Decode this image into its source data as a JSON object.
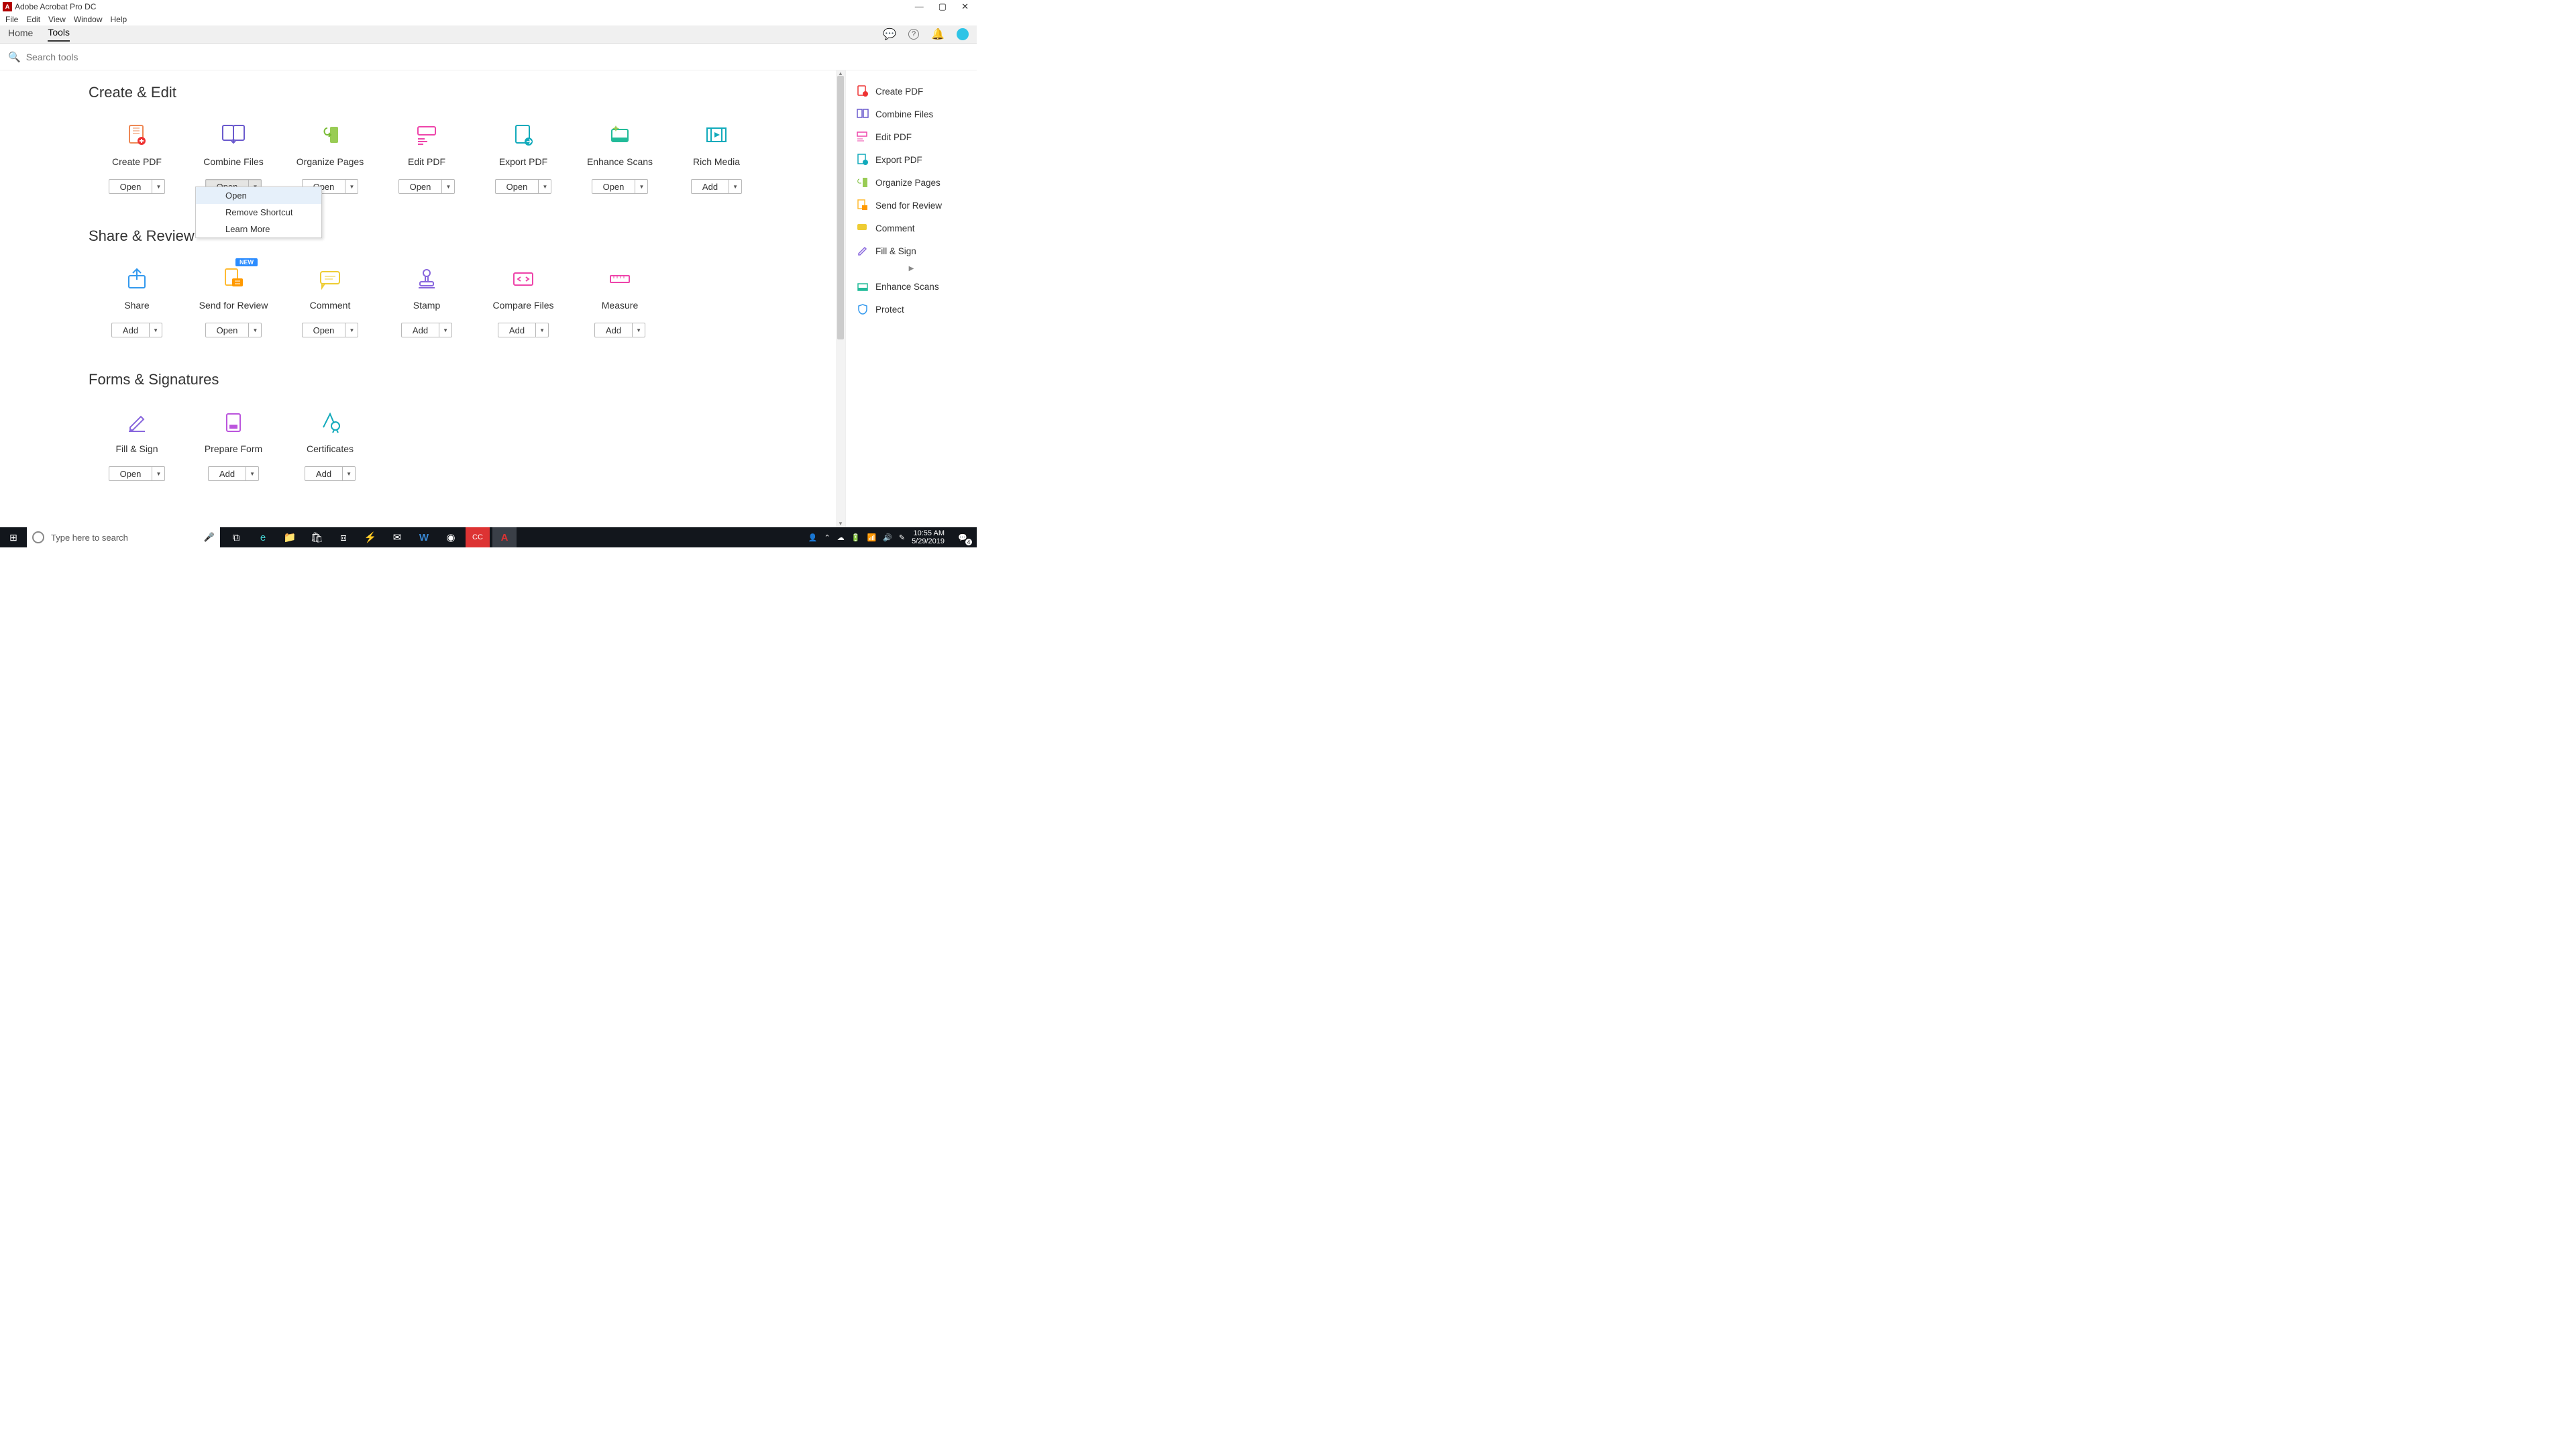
{
  "titlebar": {
    "title": "Adobe Acrobat Pro DC"
  },
  "menubar": [
    "File",
    "Edit",
    "View",
    "Window",
    "Help"
  ],
  "tabs": {
    "home": "Home",
    "tools": "Tools"
  },
  "search": {
    "placeholder": "Search tools"
  },
  "sections": {
    "create": {
      "title": "Create & Edit",
      "tools": [
        {
          "label": "Create PDF",
          "btn": "Open"
        },
        {
          "label": "Combine Files",
          "btn": "Open"
        },
        {
          "label": "Organize Pages",
          "btn": "Open"
        },
        {
          "label": "Edit PDF",
          "btn": "Open"
        },
        {
          "label": "Export PDF",
          "btn": "Open"
        },
        {
          "label": "Enhance Scans",
          "btn": "Open"
        },
        {
          "label": "Rich Media",
          "btn": "Add"
        }
      ]
    },
    "share": {
      "title": "Share & Review",
      "tools": [
        {
          "label": "Share",
          "btn": "Add"
        },
        {
          "label": "Send for Review",
          "btn": "Open",
          "badge": "NEW"
        },
        {
          "label": "Comment",
          "btn": "Open"
        },
        {
          "label": "Stamp",
          "btn": "Add"
        },
        {
          "label": "Compare Files",
          "btn": "Add"
        },
        {
          "label": "Measure",
          "btn": "Add"
        }
      ]
    },
    "forms": {
      "title": "Forms & Signatures",
      "tools": [
        {
          "label": "Fill & Sign",
          "btn": "Open"
        },
        {
          "label": "Prepare Form",
          "btn": "Add"
        },
        {
          "label": "Certificates",
          "btn": "Add"
        }
      ]
    }
  },
  "dropdown": {
    "items": [
      "Open",
      "Remove Shortcut",
      "Learn More"
    ]
  },
  "rightPanel": [
    "Create PDF",
    "Combine Files",
    "Edit PDF",
    "Export PDF",
    "Organize Pages",
    "Send for Review",
    "Comment",
    "Fill & Sign",
    "Enhance Scans",
    "Protect"
  ],
  "taskbar": {
    "searchPlaceholder": "Type here to search",
    "time": "10:55 AM",
    "date": "5/29/2019",
    "notifCount": "4"
  }
}
